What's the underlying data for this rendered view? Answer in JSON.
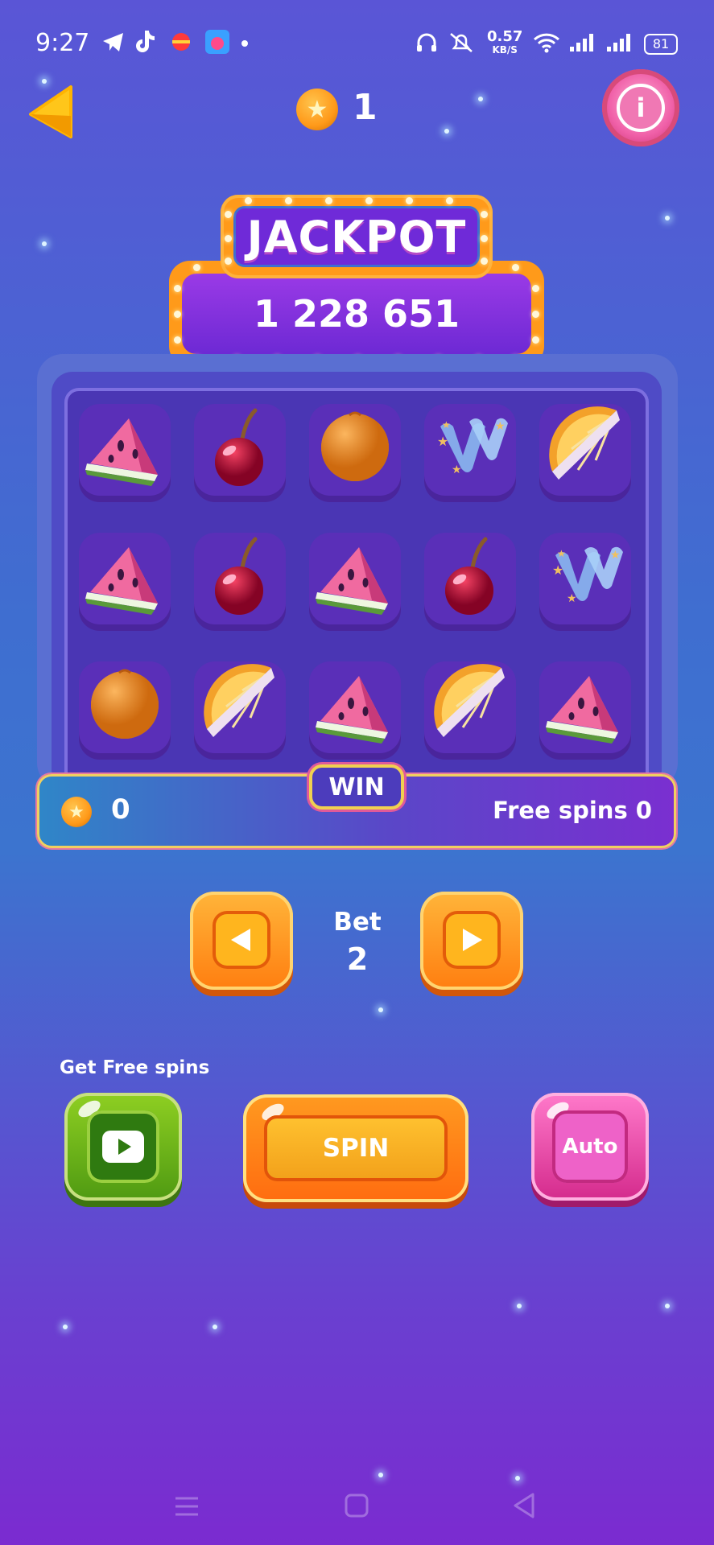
{
  "status_bar": {
    "time": "9:27",
    "net_speed": "0.57",
    "net_unit": "KB/S",
    "battery": "81"
  },
  "header": {
    "coins": "1"
  },
  "jackpot": {
    "title": "JACKPOT",
    "value": "1 228 651"
  },
  "reel": {
    "rows": [
      [
        "watermelon",
        "cherry",
        "orange",
        "wild",
        "orange-slice"
      ],
      [
        "watermelon",
        "cherry",
        "watermelon",
        "cherry",
        "wild"
      ],
      [
        "orange",
        "orange-slice",
        "watermelon",
        "orange-slice",
        "watermelon"
      ]
    ]
  },
  "win": {
    "label": "WIN",
    "value": "0",
    "free_spins": "Free spins 0"
  },
  "bet": {
    "label": "Bet",
    "value": "2"
  },
  "controls": {
    "free_spins_label": "Get Free spins",
    "spin_label": "SPIN",
    "auto_label": "Auto"
  },
  "colors": {
    "accent_orange": "#ff9a1a",
    "jackpot_purple": "#6f2ad8",
    "spin_yellow": "#ffc230"
  },
  "icons": [
    "back-arrow-icon",
    "coin-icon",
    "info-icon",
    "play-video-icon",
    "left-arrow-icon",
    "right-arrow-icon"
  ]
}
